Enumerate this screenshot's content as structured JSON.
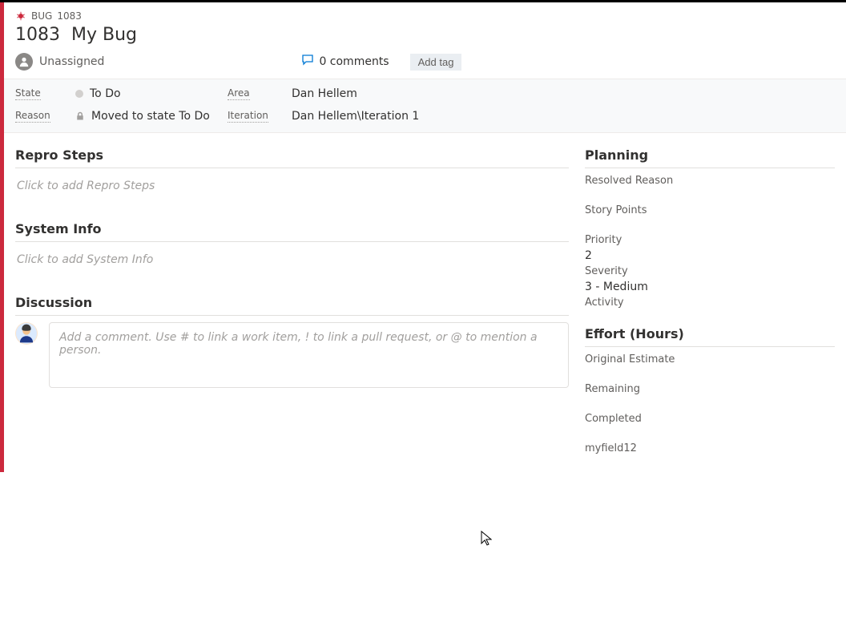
{
  "crumb": {
    "type": "BUG",
    "id": "1083"
  },
  "id": "1083",
  "title": "My Bug",
  "assignee": "Unassigned",
  "comments_label": "0 comments",
  "addtag_label": "Add tag",
  "band": {
    "state_label": "State",
    "state_value": "To Do",
    "reason_label": "Reason",
    "reason_value": "Moved to state To Do",
    "area_label": "Area",
    "area_value": "Dan Hellem",
    "iteration_label": "Iteration",
    "iteration_value": "Dan Hellem\\Iteration 1"
  },
  "sections": {
    "repro_head": "Repro Steps",
    "repro_ph": "Click to add Repro Steps",
    "sysinfo_head": "System Info",
    "sysinfo_ph": "Click to add System Info",
    "discussion_head": "Discussion",
    "comment_ph": "Add a comment. Use # to link a work item, ! to link a pull request, or @ to mention a person."
  },
  "planning": {
    "head": "Planning",
    "resolved_reason_label": "Resolved Reason",
    "story_points_label": "Story Points",
    "priority_label": "Priority",
    "priority_value": "2",
    "severity_label": "Severity",
    "severity_value": "3 - Medium",
    "activity_label": "Activity"
  },
  "effort": {
    "head": "Effort (Hours)",
    "original_label": "Original Estimate",
    "remaining_label": "Remaining",
    "completed_label": "Completed",
    "myfield_label": "myfield12"
  }
}
